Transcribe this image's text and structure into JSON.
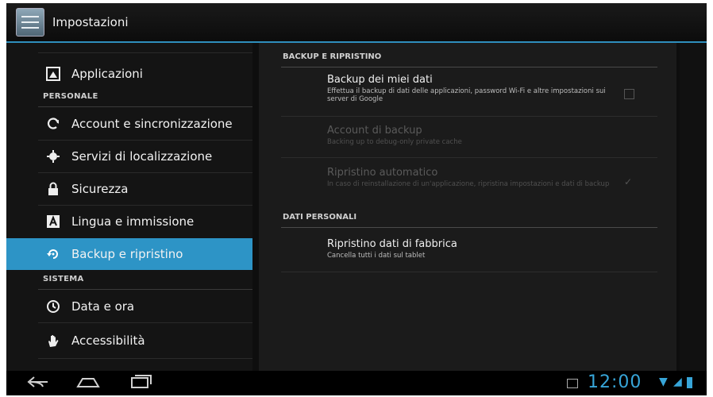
{
  "window": {
    "title": "Impostazioni",
    "icon": "settings-app-icon"
  },
  "sidebar": {
    "items": [
      {
        "label": "Applicazioni",
        "icon": "apps-icon"
      },
      {
        "label": "Account e sincronizzazione",
        "icon": "sync-icon"
      },
      {
        "label": "Servizi di localizzazione",
        "icon": "location-icon"
      },
      {
        "label": "Sicurezza",
        "icon": "lock-icon"
      },
      {
        "label": "Lingua e immissione",
        "icon": "language-icon"
      },
      {
        "label": "Backup e ripristino",
        "icon": "backup-icon",
        "selected": true
      },
      {
        "label": "Data e ora",
        "icon": "clock-icon"
      },
      {
        "label": "Accessibilità",
        "icon": "hand-icon"
      }
    ],
    "sections": {
      "personal": "PERSONALE",
      "system": "SISTEMA"
    }
  },
  "main": {
    "backup_header": "BACKUP E RIPRISTINO",
    "personal_header": "DATI PERSONALI",
    "prefs": [
      {
        "title": "Backup dei miei dati",
        "summary": "Effettua il backup di dati delle applicazioni, password Wi-Fi e altre impostazioni sui server di Google",
        "enabled": true,
        "control": "checkbox",
        "checked": false
      },
      {
        "title": "Account di backup",
        "summary": "Backing up to debug-only private cache",
        "enabled": false
      },
      {
        "title": "Ripristino automatico",
        "summary": "In caso di reinstallazione di un'applicazione, ripristina impostazioni e dati di backup",
        "enabled": false,
        "control": "checkbox",
        "checked": true
      },
      {
        "title": "Ripristino dati di fabbrica",
        "summary": "Cancella tutti i dati sul tablet",
        "enabled": true
      }
    ]
  },
  "status": {
    "time": "12:00"
  },
  "colors": {
    "accent": "#2d94c6",
    "clock": "#37a5d8"
  }
}
